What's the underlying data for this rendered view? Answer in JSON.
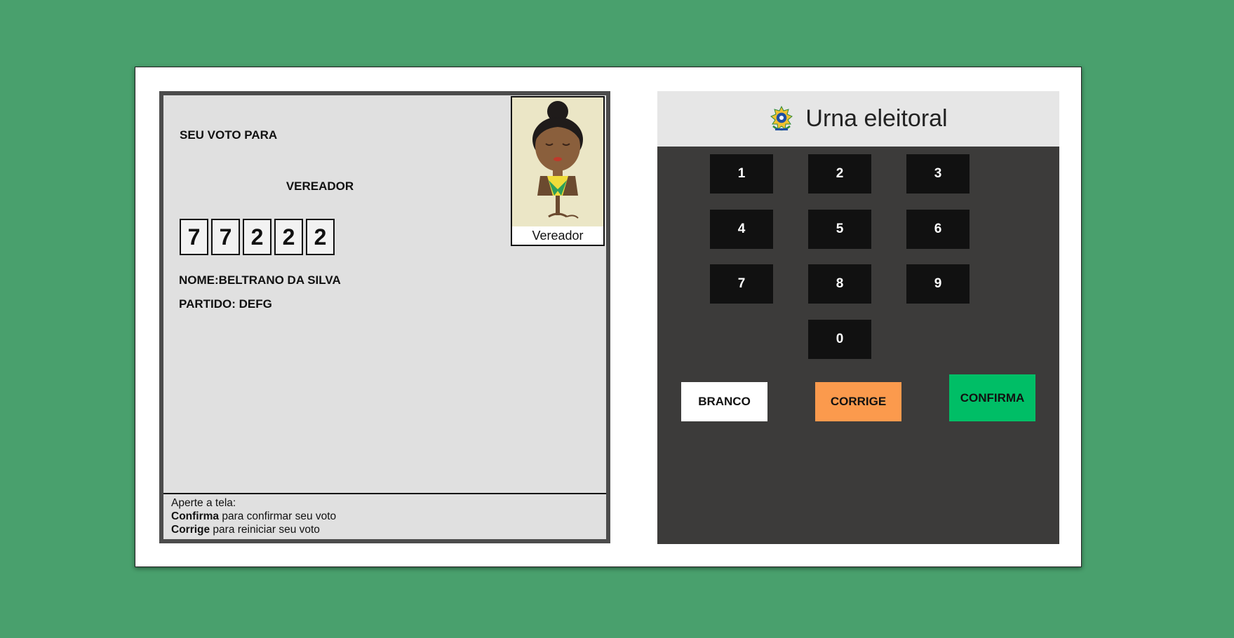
{
  "tela": {
    "seu_voto_para": "SEU VOTO PARA",
    "cargo": "VEREADOR",
    "numero": [
      "7",
      "7",
      "2",
      "2",
      "2"
    ],
    "nome": "NOME:BELTRANO DA SILVA",
    "partido": "PARTIDO: DEFG",
    "foto_legenda": "Vereador",
    "instrucoes": {
      "linha1": "Aperte a tela:",
      "confirma_bold": "Confirma",
      "confirma_text": " para confirmar seu voto",
      "corrige_bold": "Corrige",
      "corrige_text": " para reiniciar seu voto"
    }
  },
  "teclado": {
    "titulo": "Urna eleitoral",
    "teclas": [
      "1",
      "2",
      "3",
      "4",
      "5",
      "6",
      "7",
      "8",
      "9",
      "0"
    ],
    "branco": "BRANCO",
    "corrige": "CORRIGE",
    "confirma": "CONFIRMA"
  },
  "colors": {
    "background": "#49a06d",
    "keypad": "#3c3b3a",
    "key": "#111111",
    "corrige": "#fb9a4d",
    "confirma": "#00be66",
    "branco": "#ffffff"
  },
  "icons": {
    "brasao": "brazil-coat-of-arms-icon",
    "foto": "candidate-photo"
  }
}
